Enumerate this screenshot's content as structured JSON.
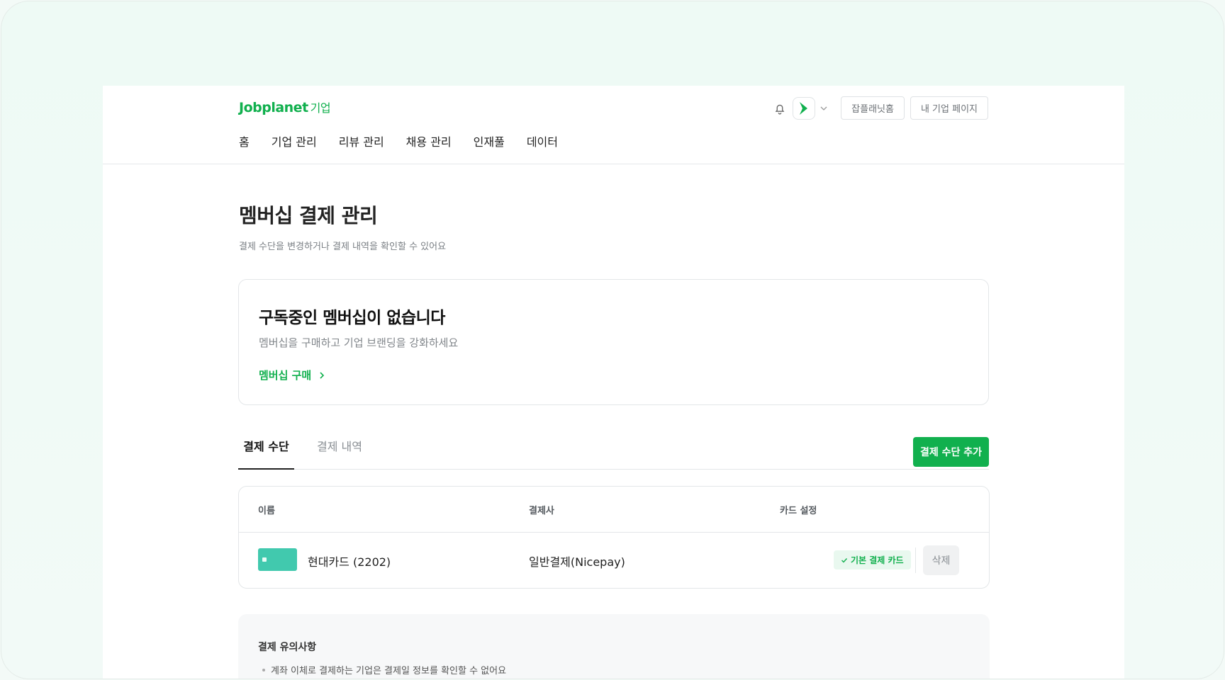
{
  "brand": {
    "name": "Jobplanet",
    "suffix": "기업",
    "color": "#11b04e"
  },
  "nav": {
    "items": [
      "홈",
      "기업 관리",
      "리뷰 관리",
      "채용 관리",
      "인재풀",
      "데이터"
    ]
  },
  "header_actions": {
    "bell_icon": "bell-icon",
    "jobplanet_home": "잡플래닛홈",
    "my_company_page": "내 기업 페이지"
  },
  "page": {
    "title": "멤버십 결제 관리",
    "subtitle": "결제 수단을 변경하거나 결제 내역을 확인할 수 있어요"
  },
  "membership_card": {
    "title": "구독중인 멤버십이 없습니다",
    "description": "멤버십을 구매하고 기업 브랜딩을 강화하세요",
    "link": "멤버십 구매"
  },
  "tabs": [
    {
      "label": "결제 수단",
      "active": true
    },
    {
      "label": "결제 내역",
      "active": false
    }
  ],
  "add_button": "결제 수단 추가",
  "table": {
    "headers": [
      "이름",
      "결제사",
      "카드 설정"
    ],
    "rows": [
      {
        "card_name": "현대카드 (2202)",
        "payment_company": "일반결제(Nicepay)",
        "badge": "기본 결제 카드",
        "delete": "삭제",
        "card_color": "#41c9ae"
      }
    ]
  },
  "notice": {
    "title": "결제 유의사항",
    "items": [
      "계좌 이체로 결제하는 기업은 결제일 정보를 확인할 수 없어요"
    ]
  }
}
